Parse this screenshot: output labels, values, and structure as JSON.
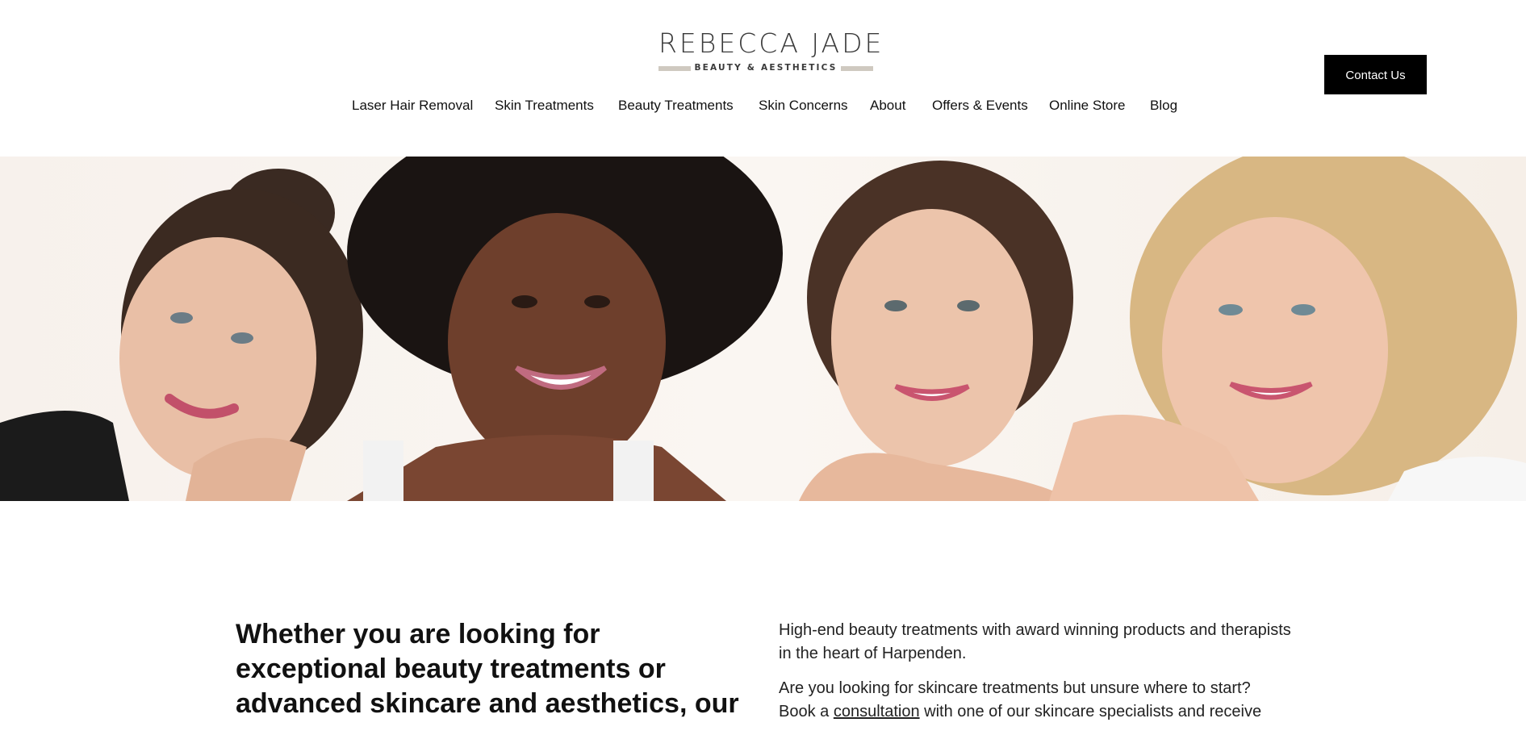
{
  "brand": {
    "name": "REBECCA JADE",
    "tagline": "BEAUTY & AESTHETICS",
    "accent_color": "#cfc9c0"
  },
  "header": {
    "contact_label": "Contact Us"
  },
  "nav": {
    "items": [
      {
        "label": "Laser Hair Removal"
      },
      {
        "label": "Skin Treatments"
      },
      {
        "label": "Beauty Treatments"
      },
      {
        "label": "Skin Concerns"
      },
      {
        "label": "About"
      },
      {
        "label": "Offers & Events"
      },
      {
        "label": "Online Store"
      },
      {
        "label": "Blog"
      }
    ]
  },
  "intro": {
    "heading": "Whether you are looking for exceptional beauty treatments or advanced skincare and aesthetics, our",
    "para1": "High-end beauty treatments with award winning products and therapists in the heart of Harpenden.",
    "para2_line1": "Are you looking for skincare treatments but unsure where to start?",
    "para2_pre": "Book a ",
    "para2_link": "consultation",
    "para2_post": " with one of our skincare specialists and receive"
  }
}
